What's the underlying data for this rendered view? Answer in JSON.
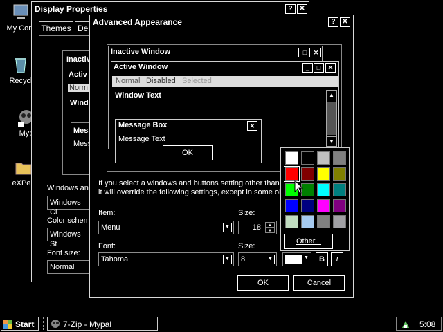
{
  "desktop": {
    "icons": [
      {
        "label": "My Com"
      },
      {
        "label": "Recycl"
      },
      {
        "label": "Myp"
      },
      {
        "label": "eXPeri"
      }
    ]
  },
  "display_properties": {
    "title": "Display Properties",
    "tabs": [
      "Themes",
      "Des"
    ],
    "inner_inactive": "Inactiv",
    "inner_active": "Activ",
    "inner_normal": "Norm",
    "inner_window": "Windo",
    "inner_msg": "Mess",
    "inner_msg2": "Mess",
    "windows_label": "Windows and",
    "windows_value": "Windows Cl",
    "color_label": "Color scheme",
    "color_value": "Windows St",
    "font_size_label": "Font size:",
    "font_size_value": "Normal"
  },
  "advanced": {
    "title": "Advanced Appearance",
    "preview": {
      "inactive_title": "Inactive Window",
      "active_title": "Active Window",
      "menu": [
        "Normal",
        "Disabled",
        "Selected"
      ],
      "window_text": "Window Text",
      "msg_title": "Message Box",
      "msg_text": "Message Text",
      "ok": "OK"
    },
    "info_line1": "If you select a windows and buttons setting other than",
    "info_line2": "it will override the following settings, except in some old",
    "item_label": "Item:",
    "item_value": "Menu",
    "size_label": "Size:",
    "size_value": "18",
    "font_label": "Font:",
    "font_value": "Tahoma",
    "font_size_label": "Size:",
    "font_size_value": "8",
    "bold": "B",
    "italic": "I",
    "ok": "OK",
    "cancel": "Cancel"
  },
  "palette": {
    "colors": [
      "#ffffff",
      "#000000",
      "#c0c0c0",
      "#808080",
      "#ff0000",
      "#800000",
      "#ffff00",
      "#808000",
      "#00ff00",
      "#008000",
      "#00ffff",
      "#008080",
      "#0000ff",
      "#000080",
      "#ff00ff",
      "#800080",
      "#c0dcc0",
      "#a6caf0",
      "#808080",
      "#a0a0a4"
    ],
    "selected_index": 4,
    "other": "Other..."
  },
  "color_button": {
    "value": "#ffffff"
  },
  "taskbar": {
    "start": "Start",
    "task": "7-Zip - Mypal",
    "time": "5:08"
  }
}
